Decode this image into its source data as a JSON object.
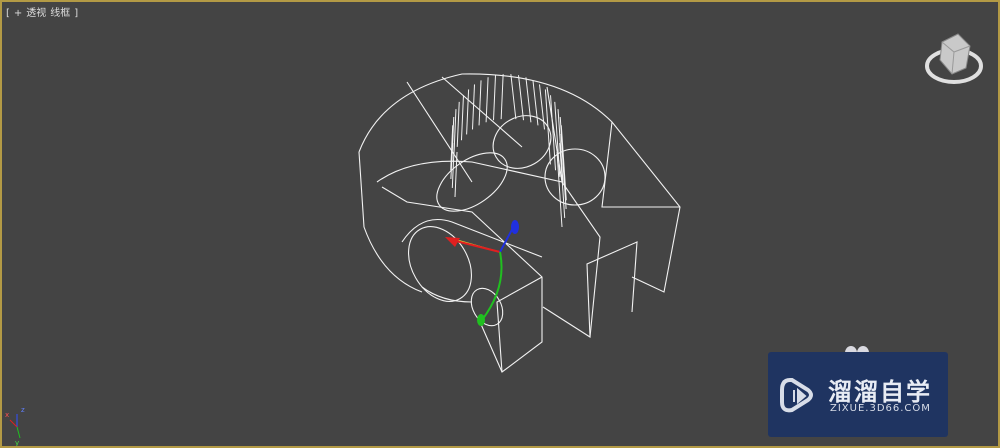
{
  "viewport": {
    "label": {
      "bracket_open": "[",
      "plus": "+",
      "view": "透视",
      "shading": "线框",
      "bracket_close": "]"
    },
    "border_color": "#b39a45",
    "background": "#444444"
  },
  "watermark": {
    "title": "溜溜自学",
    "url": "ZIXUE.3D66.COM",
    "bg": "#1f3461"
  },
  "axis_colors": {
    "x": "#e02020",
    "y": "#20c020",
    "z": "#2030e0"
  }
}
